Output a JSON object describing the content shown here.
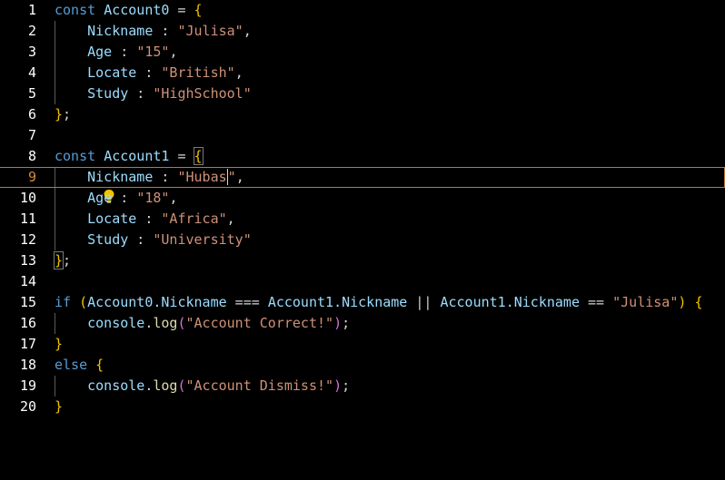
{
  "editor": {
    "line_numbers": [
      "1",
      "2",
      "3",
      "4",
      "5",
      "6",
      "7",
      "8",
      "9",
      "10",
      "11",
      "12",
      "13",
      "14",
      "15",
      "16",
      "17",
      "18",
      "19",
      "20"
    ],
    "current_line": 9
  },
  "code": {
    "kw_const": "const",
    "account0": "Account0",
    "account1": "Account1",
    "eq": " = ",
    "open_brace": "{",
    "close_brace": "}",
    "close_brace_semi": ";",
    "nickname": "Nickname",
    "age": "Age",
    "locate": "Locate",
    "study": "Study",
    "colon": " : ",
    "comma": ",",
    "a0_nickname": "\"Julisa\"",
    "a0_age": "\"15\"",
    "a0_locate": "\"British\"",
    "a0_study": "\"HighSchool\"",
    "a1_nickname_pre": "\"Hubas",
    "a1_nickname_post": "\"",
    "a1_age": "\"18\"",
    "a1_locate": "\"Africa\"",
    "a1_study": "\"University\"",
    "kw_if": "if",
    "kw_else": "else",
    "paren_open": "(",
    "paren_close": ")",
    "dot_nickname": ".Nickname",
    "strict_eq": " === ",
    "or": " || ",
    "loose_eq": " == ",
    "julisa": "\"Julisa\"",
    "console": "console",
    "dot": ".",
    "log": "log",
    "msg_correct": "\"Account Correct!\"",
    "msg_dismiss": "\"Account Dismiss!\"",
    "semi": ";",
    "space": " "
  },
  "icons": {
    "lightbulb": "lightbulb-icon"
  }
}
